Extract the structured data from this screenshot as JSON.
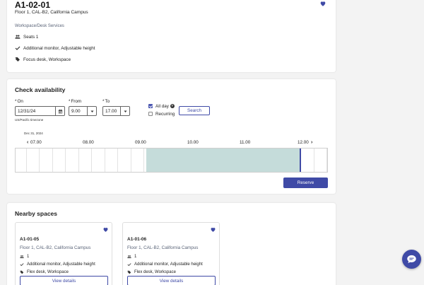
{
  "desk": {
    "name": "A1-02-01",
    "location": "Floor 1, CAL-B2, California Campus",
    "category": "Workspace/Desk Services",
    "features": [
      {
        "icon": "people-icon",
        "text": "Seats 1"
      },
      {
        "icon": "check-icon",
        "text": "Additional monitor, Adjustable height"
      },
      {
        "icon": "tags-icon",
        "text": "Focus desk, Workspace"
      }
    ]
  },
  "availability": {
    "title": "Check availability",
    "on": {
      "label": "On",
      "value": "12/31/24"
    },
    "from": {
      "label": "From",
      "value": "9.00"
    },
    "to": {
      "label": "To",
      "value": "17.00"
    },
    "timezone": "US/Pacific timezone",
    "all_day": {
      "label": "All day",
      "checked": true
    },
    "recurring": {
      "label": "Recurring",
      "checked": false
    },
    "search_label": "Search",
    "required_mark": "*",
    "timeline": {
      "date": "Dec 31, 2024",
      "hours": [
        "07.00",
        "08.00",
        "09.00",
        "10.00",
        "11.00",
        "12.00"
      ],
      "booked_from": 9.05,
      "booked_to": 12.0
    },
    "reserve_label": "Reserve"
  },
  "nearby": {
    "title": "Nearby spaces",
    "spaces": [
      {
        "name": "A1-01-05",
        "location": "Floor 1, CAL-B2, California Campus",
        "seats": "1",
        "amenities": "Additional monitor, Adjustable height",
        "tags": "Flex desk, Workspace",
        "button": "View details"
      },
      {
        "name": "A1-01-06",
        "location": "Floor 1, CAL-B2, California Campus",
        "seats": "1",
        "amenities": "Additional monitor, Adjustable height",
        "tags": "Flex desk, Workspace",
        "button": "View details"
      }
    ]
  },
  "colors": {
    "accent": "#3f4aa6",
    "booked": "#c5dcda"
  }
}
